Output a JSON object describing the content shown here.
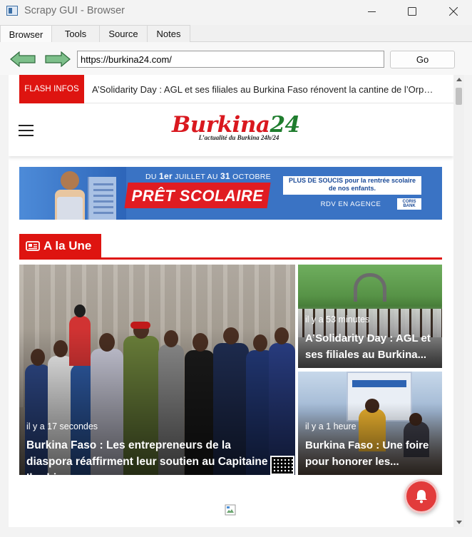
{
  "window": {
    "title": "Scrapy GUI - Browser"
  },
  "tabs": [
    {
      "label": "Browser",
      "active": true
    },
    {
      "label": "Tools",
      "active": false
    },
    {
      "label": "Source",
      "active": false
    },
    {
      "label": "Notes",
      "active": false
    }
  ],
  "nav": {
    "url": "https://burkina24.com/",
    "go_label": "Go",
    "back_icon": "arrow-left-icon",
    "forward_icon": "arrow-right-icon"
  },
  "site": {
    "flash_label": "FLASH INFOS",
    "flash_text": "A’Solidarity Day : AGL et ses filiales au Burkina Faso rénovent la cantine de l’Orphelinat",
    "logo_main": "Burkina",
    "logo_num": "24",
    "logo_tagline": "L’actualité du Burkina 24h/24",
    "ad": {
      "date_line_pre": "DU",
      "date_1": "1er",
      "date_mid": "JUILLET AU",
      "date_2": "31",
      "date_post": "OCTOBRE",
      "headline": "PRÊT SCOLAIRE",
      "right_text": "PLUS DE SOUCIS pour la rentrée scolaire de nos enfants.",
      "rdv": "RDV EN AGENCE",
      "bank": "CORIS BANK"
    },
    "section_title": "A la Une",
    "articles": [
      {
        "time": "il y a 17 secondes",
        "title": "Burkina Faso : Les entrepreneurs de la diaspora réaffirment leur soutien au Capitaine Ibrahim..."
      },
      {
        "time": "il y a 53 minutes",
        "title": "A’Solidarity Day : AGL et ses filiales au Burkina..."
      },
      {
        "time": "il y a 1 heure",
        "title": "Burkina Faso : Une foire pour honorer les..."
      }
    ]
  },
  "colors": {
    "brand_red": "#de1410",
    "logo_red": "#d9181f",
    "logo_green": "#1f7d2e",
    "arrow_green": "#7dbf8a"
  }
}
